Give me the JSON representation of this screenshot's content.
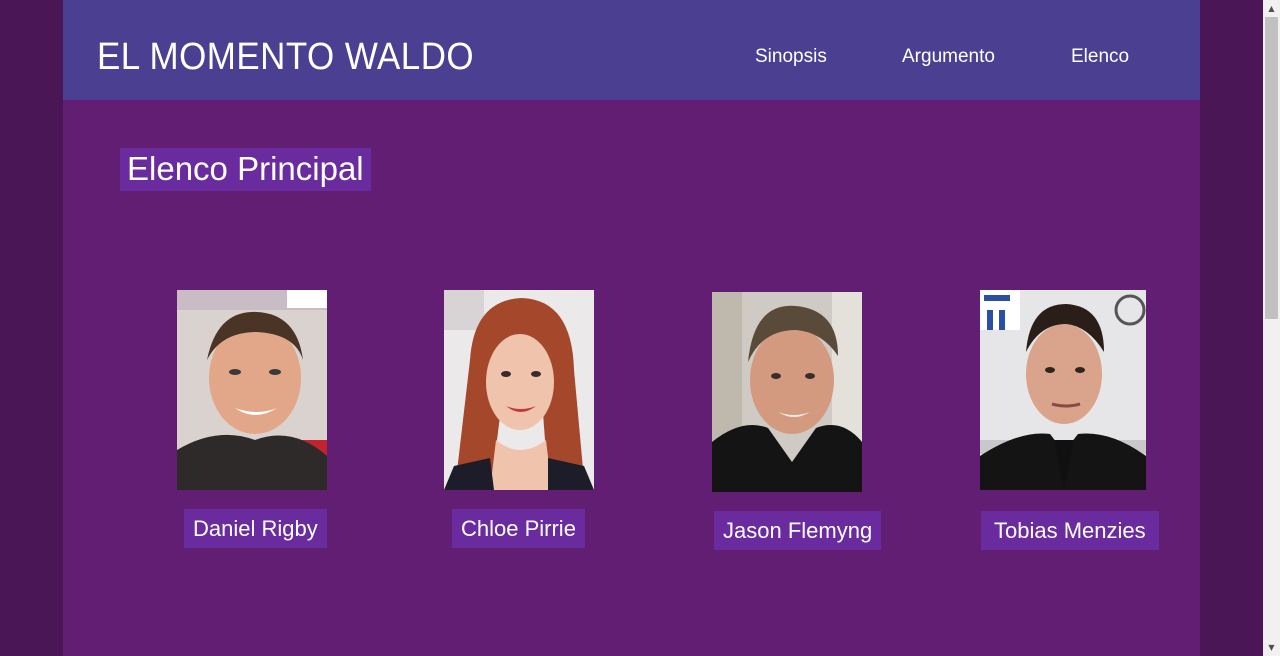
{
  "header": {
    "site_title": "EL MOMENTO WALDO",
    "nav": [
      {
        "label": "Sinopsis"
      },
      {
        "label": "Argumento"
      },
      {
        "label": "Elenco"
      }
    ]
  },
  "main": {
    "heading": "Elenco Principal",
    "cast": [
      {
        "name": "Daniel Rigby"
      },
      {
        "name": "Chloe Pirrie"
      },
      {
        "name": "Jason Flemyng"
      },
      {
        "name": "Tobias Menzies"
      }
    ]
  },
  "colors": {
    "outer_background": "#4a1656",
    "page_background": "#611e73",
    "header_background": "#4b3f91",
    "label_background": "#6a2b9e",
    "text": "#ffffff"
  },
  "icons": {
    "scroll_up": "scroll-up-arrow-icon",
    "scroll_down": "scroll-down-arrow-icon"
  }
}
